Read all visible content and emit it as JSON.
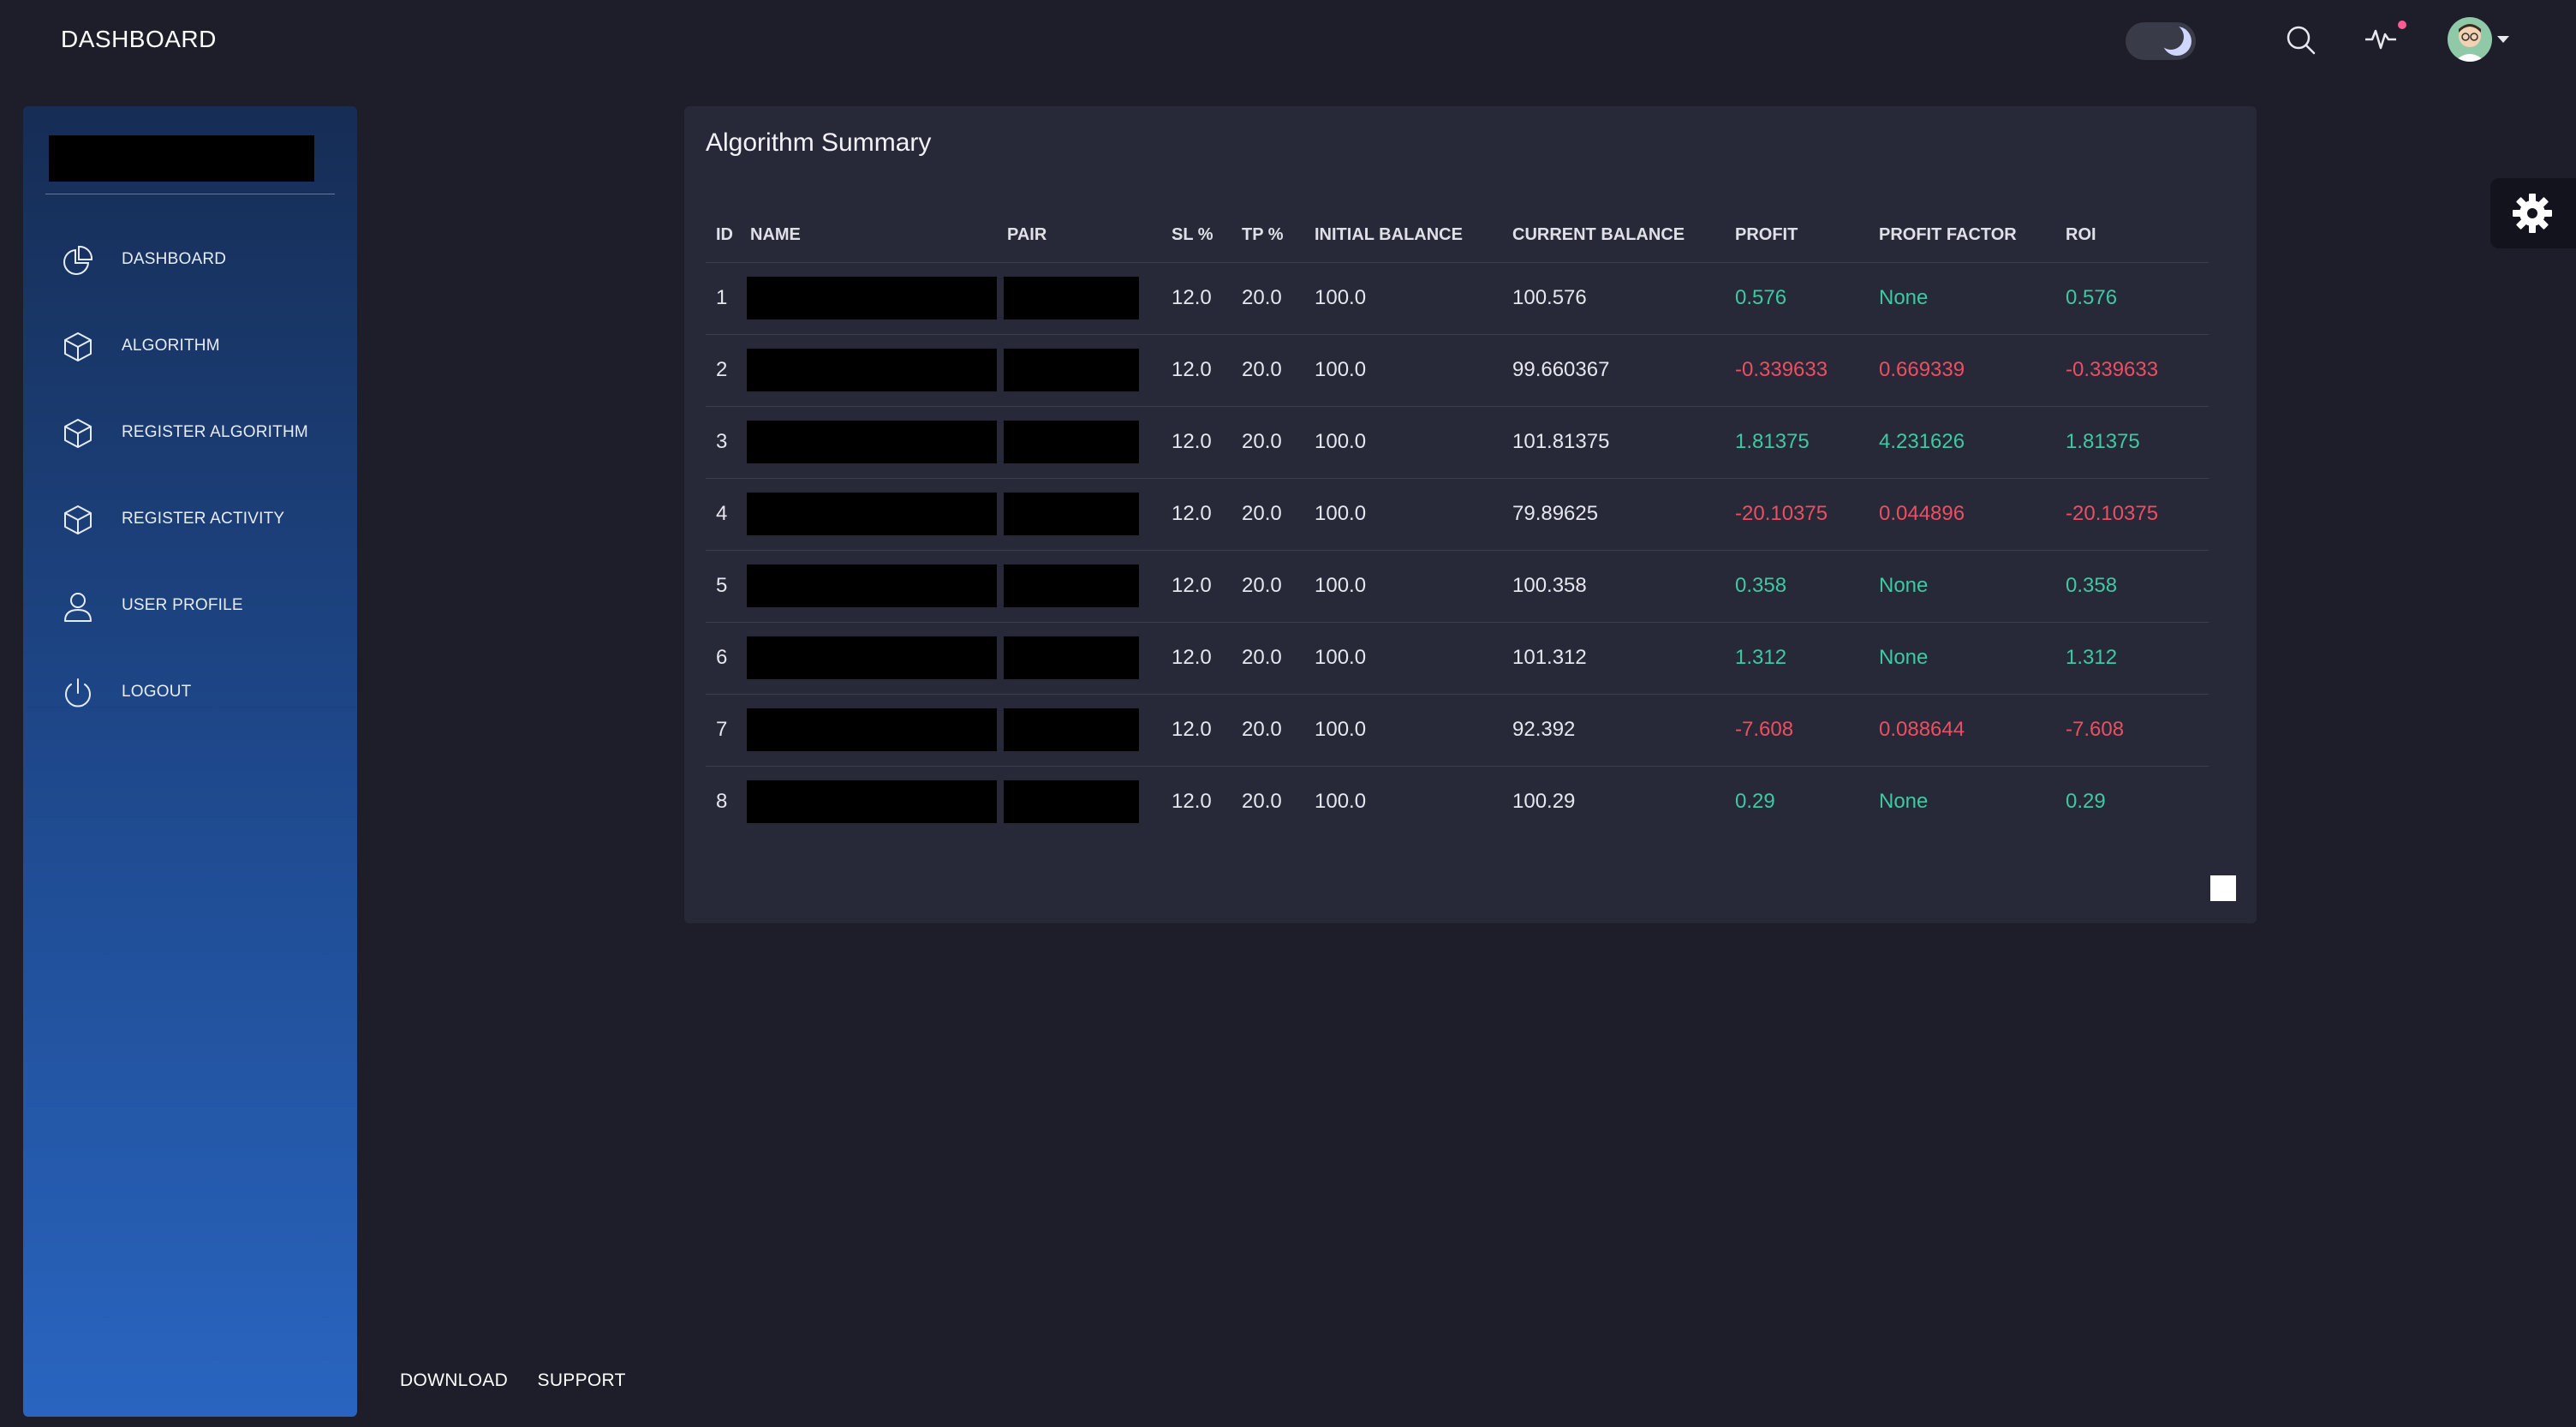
{
  "navbar": {
    "brand": "DASHBOARD",
    "icons": [
      "theme-toggle",
      "search-icon",
      "activity-icon",
      "avatar"
    ]
  },
  "sidebar": {
    "items": [
      {
        "label": "DASHBOARD",
        "icon": "pie-chart-icon"
      },
      {
        "label": "ALGORITHM",
        "icon": "cube-icon"
      },
      {
        "label": "REGISTER ALGORITHM",
        "icon": "cube-icon"
      },
      {
        "label": "REGISTER ACTIVITY",
        "icon": "cube-icon"
      },
      {
        "label": "USER PROFILE",
        "icon": "user-icon"
      },
      {
        "label": "LOGOUT",
        "icon": "power-icon"
      }
    ]
  },
  "summary": {
    "title": "Algorithm Summary",
    "columns": [
      "ID",
      "NAME",
      "PAIR",
      "SL %",
      "TP %",
      "INITIAL BALANCE",
      "CURRENT BALANCE",
      "PROFIT",
      "PROFIT FACTOR",
      "ROI"
    ],
    "rows": [
      {
        "id": "1",
        "sl": "12.0",
        "tp": "20.0",
        "initial": "100.0",
        "current": "100.576",
        "profit": "0.576",
        "factor": "None",
        "roi": "0.576",
        "profit_status": "pos",
        "factor_status": "pos"
      },
      {
        "id": "2",
        "sl": "12.0",
        "tp": "20.0",
        "initial": "100.0",
        "current": "99.660367",
        "profit": "-0.339633",
        "factor": "0.669339",
        "roi": "-0.339633",
        "profit_status": "neg",
        "factor_status": "neg"
      },
      {
        "id": "3",
        "sl": "12.0",
        "tp": "20.0",
        "initial": "100.0",
        "current": "101.81375",
        "profit": "1.81375",
        "factor": "4.231626",
        "roi": "1.81375",
        "profit_status": "pos",
        "factor_status": "pos"
      },
      {
        "id": "4",
        "sl": "12.0",
        "tp": "20.0",
        "initial": "100.0",
        "current": "79.89625",
        "profit": "-20.10375",
        "factor": "0.044896",
        "roi": "-20.10375",
        "profit_status": "neg",
        "factor_status": "neg"
      },
      {
        "id": "5",
        "sl": "12.0",
        "tp": "20.0",
        "initial": "100.0",
        "current": "100.358",
        "profit": "0.358",
        "factor": "None",
        "roi": "0.358",
        "profit_status": "pos",
        "factor_status": "pos"
      },
      {
        "id": "6",
        "sl": "12.0",
        "tp": "20.0",
        "initial": "100.0",
        "current": "101.312",
        "profit": "1.312",
        "factor": "None",
        "roi": "1.312",
        "profit_status": "pos",
        "factor_status": "pos"
      },
      {
        "id": "7",
        "sl": "12.0",
        "tp": "20.0",
        "initial": "100.0",
        "current": "92.392",
        "profit": "-7.608",
        "factor": "0.088644",
        "roi": "-7.608",
        "profit_status": "neg",
        "factor_status": "neg"
      },
      {
        "id": "8",
        "sl": "12.0",
        "tp": "20.0",
        "initial": "100.0",
        "current": "100.29",
        "profit": "0.29",
        "factor": "None",
        "roi": "0.29",
        "profit_status": "pos",
        "factor_status": "pos"
      }
    ]
  },
  "footer": {
    "download": "DOWNLOAD",
    "support": "SUPPORT"
  },
  "colors": {
    "background": "#1e1e2b",
    "card": "#272838",
    "positive": "#3ec9a2",
    "negative": "#ec4f62",
    "sidebar_top": "#162d55",
    "sidebar_bottom": "#2965c0"
  }
}
